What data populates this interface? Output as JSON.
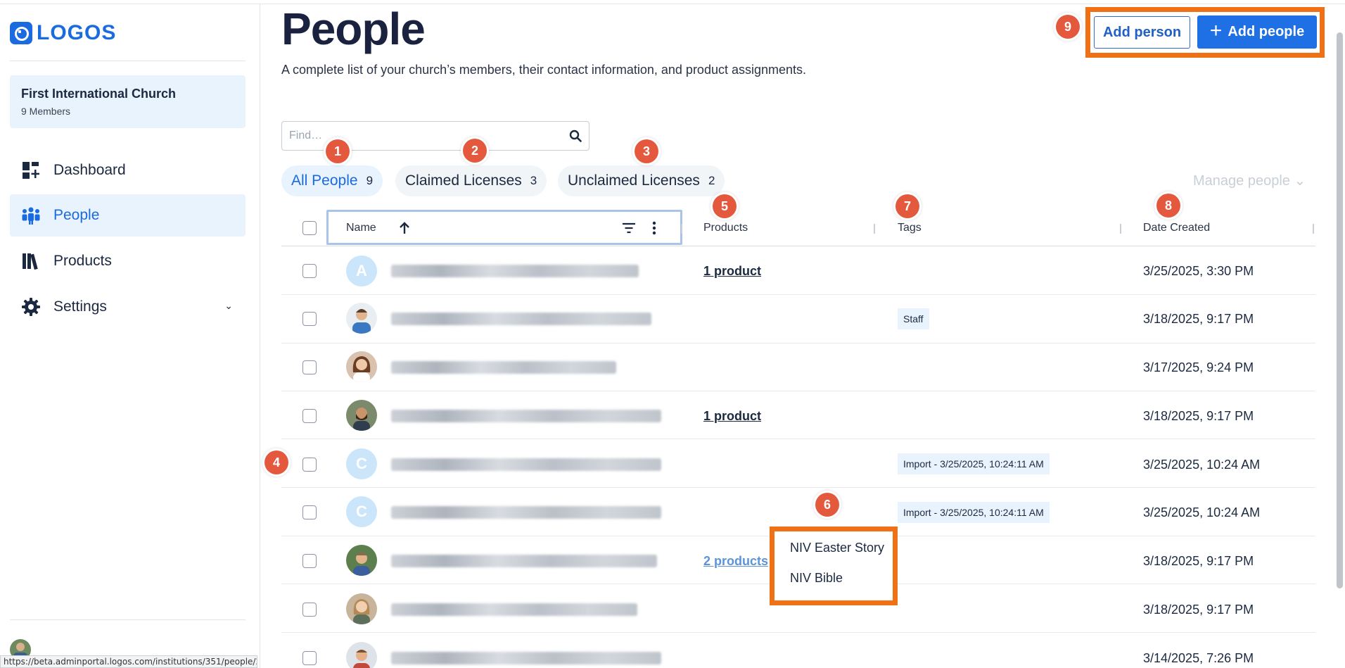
{
  "sidebar": {
    "logo_text": "LOGOS",
    "org_name": "First International Church",
    "org_members": "9 Members",
    "nav": [
      {
        "label": "Dashboard",
        "icon": "dashboard-icon"
      },
      {
        "label": "People",
        "icon": "people-icon",
        "active": true
      },
      {
        "label": "Products",
        "icon": "books-icon"
      },
      {
        "label": "Settings",
        "icon": "gear-icon",
        "expandable": true
      }
    ],
    "status_url": "https://beta.adminportal.logos.com/institutions/351/people/252377"
  },
  "header": {
    "title": "People",
    "description": "A complete list of your church’s members, their contact information, and product assignments.",
    "add_person_label": "Add person",
    "add_people_label": "Add people"
  },
  "search": {
    "placeholder": "Find…"
  },
  "filters": [
    {
      "label": "All People",
      "count": "9",
      "active": true
    },
    {
      "label": "Claimed Licenses",
      "count": "3"
    },
    {
      "label": "Unclaimed Licenses",
      "count": "2"
    }
  ],
  "manage_people_label": "Manage people ⌄",
  "columns": {
    "name": "Name",
    "products": "Products",
    "tags": "Tags",
    "date_created": "Date Created"
  },
  "rows": [
    {
      "avatar": "A",
      "products": "1 product",
      "tag": "",
      "date": "3/25/2025, 3:30 PM"
    },
    {
      "avatar": "photo",
      "products": "",
      "tag": "Staff",
      "date": "3/18/2025, 9:17 PM"
    },
    {
      "avatar": "photo",
      "products": "",
      "tag": "",
      "date": "3/17/2025, 9:24 PM"
    },
    {
      "avatar": "photo",
      "products": "1 product",
      "tag": "",
      "date": "3/18/2025, 9:17 PM"
    },
    {
      "avatar": "C",
      "products": "",
      "tag": "Import - 3/25/2025, 10:24:11 AM",
      "date": "3/25/2025, 10:24 AM"
    },
    {
      "avatar": "C",
      "products": "",
      "tag": "Import - 3/25/2025, 10:24:11 AM",
      "date": "3/25/2025, 10:24 AM"
    },
    {
      "avatar": "photo",
      "products": "2 products",
      "tag": "",
      "date": "3/18/2025, 9:17 PM"
    },
    {
      "avatar": "photo",
      "products": "",
      "tag": "",
      "date": "3/18/2025, 9:17 PM"
    },
    {
      "avatar": "photo",
      "products": "",
      "tag": "",
      "date": "3/14/2025, 7:26 PM"
    }
  ],
  "popover": {
    "items": [
      "NIV Easter Story",
      "NIV Bible"
    ]
  },
  "badges": [
    "1",
    "2",
    "3",
    "4",
    "5",
    "6",
    "7",
    "8",
    "9"
  ],
  "colors": {
    "brand": "#1a6ae0",
    "highlight": "#f07016",
    "badge": "#e4593e"
  }
}
